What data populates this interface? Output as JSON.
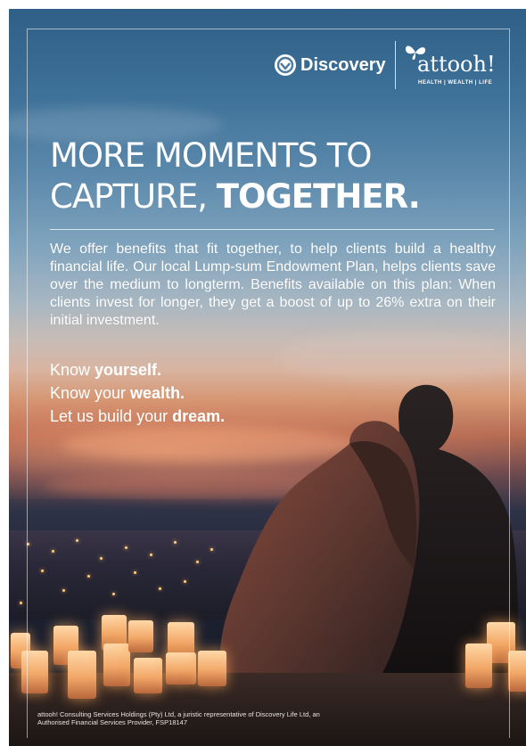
{
  "logos": {
    "discovery": "Discovery",
    "attooh": "attooh!",
    "attooh_tagline": "HEALTH | WEALTH | LIFE"
  },
  "headline": {
    "line1": "MORE MOMENTS TO",
    "line2_regular": "CAPTURE, ",
    "line2_bold": "TOGETHER."
  },
  "body": "We offer benefits that fit together, to help clients build a healthy financial life. Our local Lump-sum Endowment Plan, helps clients save over the medium to longterm. Benefits available on this plan: When clients invest for longer, they get a boost of up to 26% extra on their initial investment.",
  "tagline": [
    {
      "regular": "Know ",
      "bold": "yourself."
    },
    {
      "regular": "Know your ",
      "bold": "wealth."
    },
    {
      "regular": "Let us build your ",
      "bold": "dream."
    }
  ],
  "disclaimer": "attooh! Consulting Services Holdings (Pty) Ltd, a juristic representative of Discovery Life Ltd, an Authorised Financial Services Provider, FSP18147",
  "colors": {
    "sky_top": "#2f5f86",
    "sunset": "#d59673",
    "text": "#ffffff"
  }
}
